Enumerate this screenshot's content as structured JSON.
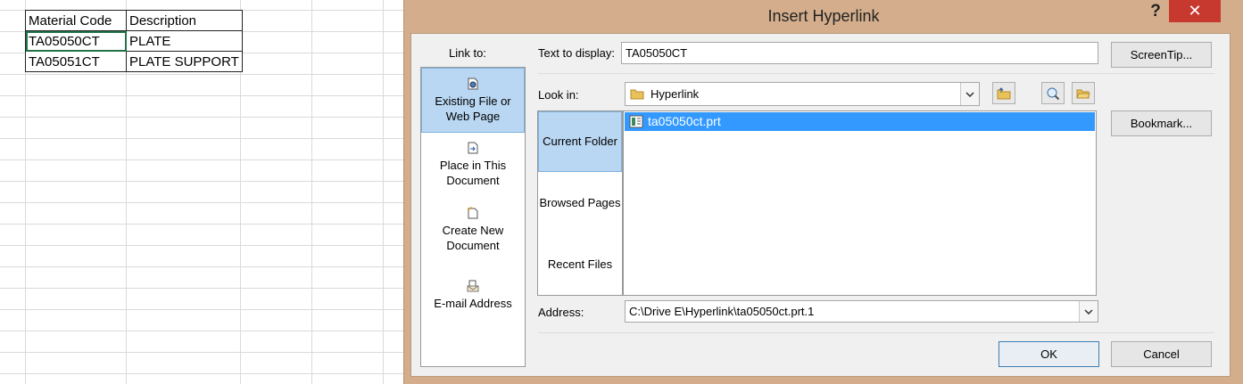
{
  "sheet": {
    "headers": [
      "Material Code",
      "Description"
    ],
    "rows": [
      [
        "TA05050CT",
        "PLATE"
      ],
      [
        "TA05051CT",
        "PLATE SUPPORT"
      ]
    ]
  },
  "dialog": {
    "title": "Insert Hyperlink",
    "help_label": "?",
    "close_label": "✕",
    "link_to_label": "Link to:",
    "link_to_items": [
      {
        "label": "Existing File or Web Page",
        "icon": "existing-file-icon",
        "active": true
      },
      {
        "label": "Place in This Document",
        "icon": "place-in-document-icon"
      },
      {
        "label": "Create New Document",
        "icon": "new-document-icon"
      },
      {
        "label": "E-mail Address",
        "icon": "email-icon"
      }
    ],
    "text_to_display_label": "Text to display:",
    "text_to_display_value": "TA05050CT",
    "screentip_label": "ScreenTip...",
    "look_in_label": "Look in:",
    "look_in_value": "Hyperlink",
    "nav_items": [
      "Current Folder",
      "Browsed Pages",
      "Recent Files"
    ],
    "files": [
      "ta05050ct.prt"
    ],
    "bookmark_label": "Bookmark...",
    "address_label": "Address:",
    "address_value": "C:\\Drive E\\Hyperlink\\ta05050ct.prt.1",
    "ok_label": "OK",
    "cancel_label": "Cancel"
  },
  "colors": {
    "frame": "#d4ae8c",
    "close": "#c7382f",
    "selection": "#3399ff",
    "active_item": "#b9d7f2"
  }
}
